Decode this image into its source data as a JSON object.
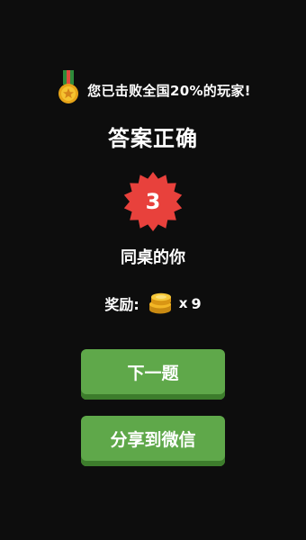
{
  "rank": {
    "icon": "medal-icon",
    "text": "您已击败全国20%的玩家!"
  },
  "result": {
    "title": "答案正确"
  },
  "level": {
    "number": "3",
    "name": "同桌的你",
    "badge_color": "#e8413c"
  },
  "reward": {
    "label": "奖励:",
    "icon": "coin-stack-icon",
    "multiplier": "x",
    "count": "9"
  },
  "buttons": {
    "next_label": "下一题",
    "share_label": "分享到微信",
    "color": "#5fa84a"
  }
}
